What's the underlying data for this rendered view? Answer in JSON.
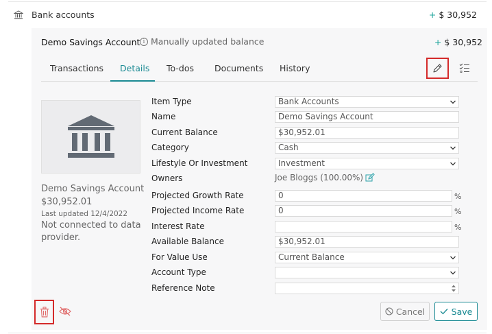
{
  "group": {
    "label": "Bank accounts",
    "amount_sign": "+",
    "amount": "$ 30,952",
    "icon": "bank-icon"
  },
  "account": {
    "title": "Demo Savings Account",
    "info_text": "Manually updated balance",
    "amount_sign": "+",
    "amount": "$ 30,952"
  },
  "tabs": [
    {
      "label": "Transactions"
    },
    {
      "label": "Details",
      "active": true
    },
    {
      "label": "To-dos"
    },
    {
      "label": "Documents"
    },
    {
      "label": "History"
    }
  ],
  "sidebar": {
    "name": "Demo Savings Account",
    "balance": "$30,952.01",
    "last_updated": "Last updated 12/4/2022",
    "status": "Not connected to data provider."
  },
  "form": {
    "item_type": {
      "label": "Item Type",
      "value": "Bank Accounts"
    },
    "name": {
      "label": "Name",
      "value": "Demo Savings Account"
    },
    "current_balance": {
      "label": "Current Balance",
      "value": "$30,952.01"
    },
    "category": {
      "label": "Category",
      "value": "Cash"
    },
    "lifestyle": {
      "label": "Lifestyle Or Investment",
      "value": "Investment"
    },
    "owners": {
      "label": "Owners",
      "value": "Joe Bloggs (100.00%)"
    },
    "growth_rate": {
      "label": "Projected Growth Rate",
      "value": "0",
      "unit": "%"
    },
    "income_rate": {
      "label": "Projected Income Rate",
      "value": "0",
      "unit": "%"
    },
    "interest_rate": {
      "label": "Interest Rate",
      "value": "",
      "unit": "%"
    },
    "available_balance": {
      "label": "Available Balance",
      "value": "$30,952.01"
    },
    "for_value_use": {
      "label": "For Value Use",
      "value": "Current Balance"
    },
    "account_type": {
      "label": "Account Type",
      "value": ""
    },
    "reference_note": {
      "label": "Reference Note",
      "value": ""
    }
  },
  "actions": {
    "cancel": "Cancel",
    "save": "Save"
  },
  "colors": {
    "accent": "#1a8a93",
    "highlight": "#d42a2a",
    "plus": "#1aa39a"
  }
}
